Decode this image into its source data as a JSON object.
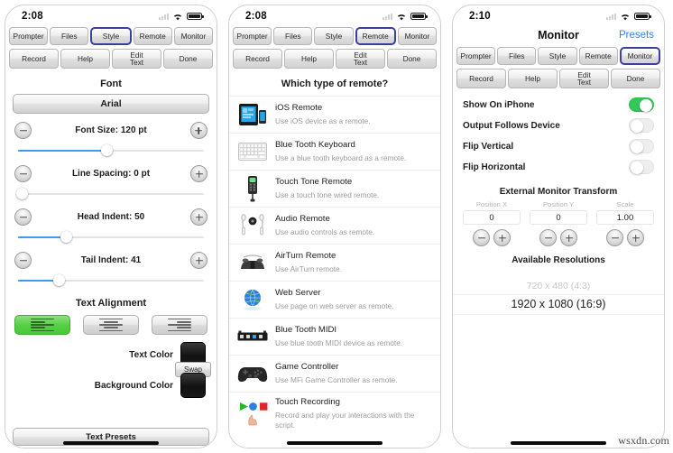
{
  "panels": [
    {
      "status": {
        "time": "2:08",
        "wifi_icon": "wifi-icon",
        "battery_icon": "battery-icon",
        "signal_icon": "signal-bars-icon"
      },
      "tabs_row1": [
        {
          "label": "Prompter",
          "selected": false
        },
        {
          "label": "Files",
          "selected": false
        },
        {
          "label": "Style",
          "selected": true
        },
        {
          "label": "Remote",
          "selected": false
        },
        {
          "label": "Monitor",
          "selected": false
        }
      ],
      "tabs_row2": [
        {
          "label": "Record",
          "selected": false
        },
        {
          "label": "Help",
          "selected": false
        },
        {
          "label": "Edit\nText",
          "selected": false
        },
        {
          "label": "Done",
          "selected": false
        }
      ],
      "style": {
        "font_section_title": "Font",
        "font_value": "Arial",
        "sliders": [
          {
            "label": "Font Size: 120 pt",
            "percent": 48,
            "minus": "minus-icon",
            "plus": "plus-icon"
          },
          {
            "label": "Line Spacing: 0 pt",
            "percent": 2,
            "minus": "minus-icon",
            "plus": "plus-icon"
          },
          {
            "label": "Head Indent: 50",
            "percent": 26,
            "minus": "minus-icon",
            "plus": "plus-icon"
          },
          {
            "label": "Tail Indent: 41",
            "percent": 22,
            "minus": "minus-icon",
            "plus": "plus-icon"
          }
        ],
        "alignment_title": "Text Alignment",
        "alignment": [
          {
            "name": "align-left",
            "active": true
          },
          {
            "name": "align-center",
            "active": false
          },
          {
            "name": "align-right",
            "active": false
          }
        ],
        "text_color_label": "Text Color",
        "text_color_value": "#151515",
        "background_color_label": "Background Color",
        "background_color_value": "#1a1a1a",
        "swap_label": "Swap",
        "presets_label": "Text Presets"
      }
    },
    {
      "status": {
        "time": "2:08",
        "wifi_icon": "wifi-icon",
        "battery_icon": "battery-icon",
        "signal_icon": "signal-bars-icon"
      },
      "tabs_row1": [
        {
          "label": "Prompter",
          "selected": false
        },
        {
          "label": "Files",
          "selected": false
        },
        {
          "label": "Style",
          "selected": false
        },
        {
          "label": "Remote",
          "selected": true
        },
        {
          "label": "Monitor",
          "selected": false
        }
      ],
      "tabs_row2": [
        {
          "label": "Record",
          "selected": false
        },
        {
          "label": "Help",
          "selected": false
        },
        {
          "label": "Edit\nText",
          "selected": false
        },
        {
          "label": "Done",
          "selected": false
        }
      ],
      "remote": {
        "question": "Which type of remote?",
        "items": [
          {
            "icon": "ipad-iphone-icon",
            "name": "iOS Remote",
            "desc": "Use iOS device as a remote."
          },
          {
            "icon": "keyboard-icon",
            "name": "Blue Tooth Keyboard",
            "desc": "Use a blue tooth keyboard as a remote."
          },
          {
            "icon": "touch-tone-remote-icon",
            "name": "Touch Tone Remote",
            "desc": "Use a touch tone wired remote."
          },
          {
            "icon": "earbuds-icon",
            "name": "Audio Remote",
            "desc": "Use audio controls as remote."
          },
          {
            "icon": "footpedal-icon",
            "name": "AirTurn Remote",
            "desc": "Use AirTurn remote."
          },
          {
            "icon": "globe-icon",
            "name": "Web Server",
            "desc": "Use page on web server as remote."
          },
          {
            "icon": "midi-device-icon",
            "name": "Blue Tooth MIDI",
            "desc": "Use blue tooth MIDI device as remote."
          },
          {
            "icon": "gamepad-icon",
            "name": "Game Controller",
            "desc": "Use MFi Game Controller as remote."
          },
          {
            "icon": "touch-recording-icon",
            "name": "Touch Recording",
            "desc": "Record and play your interactions with the script."
          }
        ]
      }
    },
    {
      "status": {
        "time": "2:10",
        "wifi_icon": "wifi-icon",
        "battery_icon": "battery-icon",
        "signal_icon": "signal-bars-icon"
      },
      "nav": {
        "title": "Monitor",
        "right_label": "Presets"
      },
      "tabs_row1": [
        {
          "label": "Prompter",
          "selected": false
        },
        {
          "label": "Files",
          "selected": false
        },
        {
          "label": "Style",
          "selected": false
        },
        {
          "label": "Remote",
          "selected": false
        },
        {
          "label": "Monitor",
          "selected": true
        }
      ],
      "tabs_row2": [
        {
          "label": "Record",
          "selected": false
        },
        {
          "label": "Help",
          "selected": false
        },
        {
          "label": "Edit\nText",
          "selected": false
        },
        {
          "label": "Done",
          "selected": false
        }
      ],
      "monitor": {
        "toggles": [
          {
            "label": "Show On iPhone",
            "on": true
          },
          {
            "label": "Output Follows Device",
            "on": false
          },
          {
            "label": "Flip Vertical",
            "on": false
          },
          {
            "label": "Flip Horizontal",
            "on": false
          }
        ],
        "transform_title": "External Monitor Transform",
        "fields": [
          {
            "caption": "Position X",
            "value": "0",
            "minus": "minus-icon",
            "plus": "plus-icon"
          },
          {
            "caption": "Position Y",
            "value": "0",
            "minus": "minus-icon",
            "plus": "plus-icon"
          },
          {
            "caption": "Scale",
            "value": "1.00",
            "minus": "minus-icon",
            "plus": "plus-icon"
          }
        ],
        "resolutions_title": "Available Resolutions",
        "resolutions": [
          {
            "label": "720 x 480 (4:3)",
            "state": "dim"
          },
          {
            "label": "1920 x 1080 (16:9)",
            "state": "current"
          }
        ]
      }
    }
  ],
  "watermark": "wsxdn.com",
  "colors": {
    "accent_blue": "#3a9bf0",
    "link_blue": "#3d7fe6",
    "toggle_green": "#34c759",
    "selection_indigo": "#3b3f9e"
  }
}
